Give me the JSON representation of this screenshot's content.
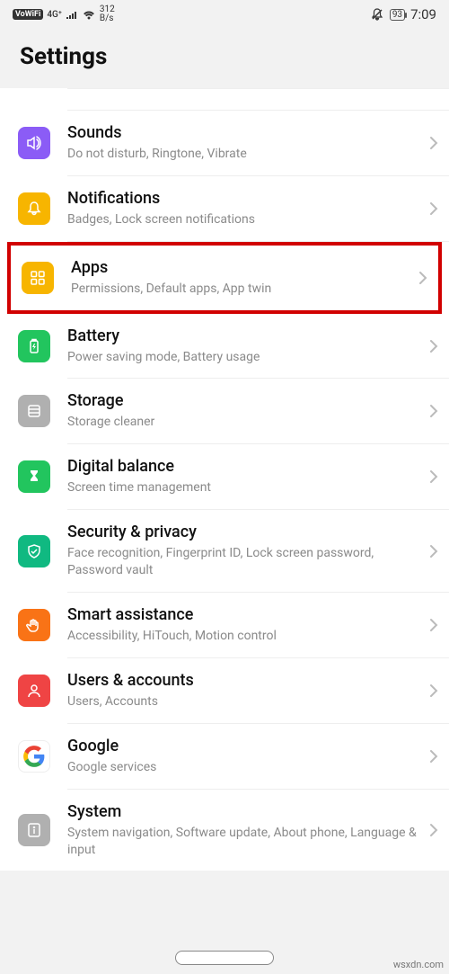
{
  "status": {
    "vowifi": "VoWiFi",
    "network": "4G⁺",
    "speed_top": "312",
    "speed_bottom": "B/s",
    "battery": "93",
    "time": "7:09"
  },
  "header": {
    "title": "Settings"
  },
  "highlighted_id": "apps",
  "rows": [
    {
      "id": "sounds",
      "title": "Sounds",
      "subtitle": "Do not disturb, Ringtone, Vibrate",
      "theme": "purple",
      "icon": "speaker"
    },
    {
      "id": "notifications",
      "title": "Notifications",
      "subtitle": "Badges, Lock screen notifications",
      "theme": "yellow",
      "icon": "bell"
    },
    {
      "id": "apps",
      "title": "Apps",
      "subtitle": "Permissions, Default apps, App twin",
      "theme": "yellow",
      "icon": "grid"
    },
    {
      "id": "battery",
      "title": "Battery",
      "subtitle": "Power saving mode, Battery usage",
      "theme": "green",
      "icon": "battery"
    },
    {
      "id": "storage",
      "title": "Storage",
      "subtitle": "Storage cleaner",
      "theme": "gray",
      "icon": "drive"
    },
    {
      "id": "digital",
      "title": "Digital balance",
      "subtitle": "Screen time management",
      "theme": "green",
      "icon": "hourglass"
    },
    {
      "id": "security",
      "title": "Security & privacy",
      "subtitle": "Face recognition, Fingerprint ID, Lock screen password, Password vault",
      "theme": "teal",
      "icon": "shield"
    },
    {
      "id": "smart",
      "title": "Smart assistance",
      "subtitle": "Accessibility, HiTouch, Motion control",
      "theme": "orange",
      "icon": "hand"
    },
    {
      "id": "users",
      "title": "Users & accounts",
      "subtitle": "Users, Accounts",
      "theme": "red",
      "icon": "person"
    },
    {
      "id": "google",
      "title": "Google",
      "subtitle": "Google services",
      "theme": "white-outline",
      "icon": "google"
    },
    {
      "id": "system",
      "title": "System",
      "subtitle": "System navigation, Software update, About phone, Language & input",
      "theme": "gray",
      "icon": "info"
    }
  ],
  "watermark": "wsxdn.com"
}
